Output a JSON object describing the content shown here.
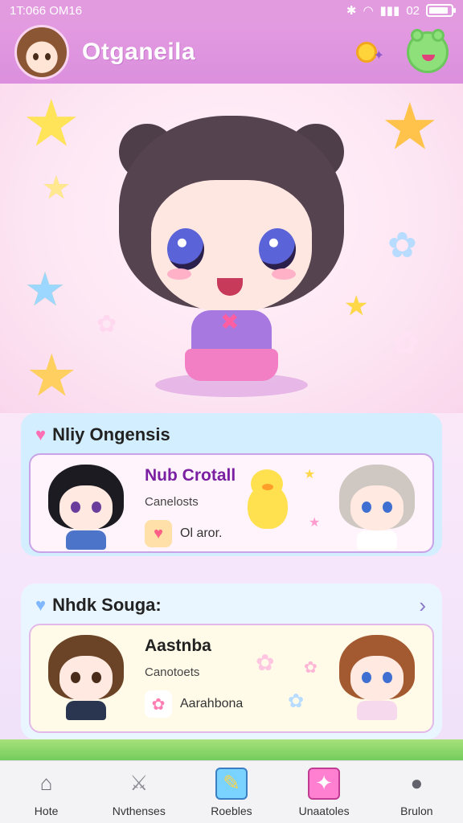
{
  "status_bar": {
    "time": "1T:066 OM16",
    "carrier": "02",
    "battery_level": 0.9
  },
  "header": {
    "title": "Otganeila"
  },
  "section_one": {
    "title": "Nliy Ongensis",
    "card": {
      "name": "Nub Crotall",
      "subtitle": "Canelosts",
      "meta": "Ol aror."
    }
  },
  "section_two": {
    "title": "Nhdk Souga:",
    "card": {
      "name": "Aastnba",
      "subtitle": "Canotoets",
      "meta": "Aarahbona"
    }
  },
  "bottom_nav": {
    "items": [
      {
        "label": "Hote",
        "icon": "home-icon"
      },
      {
        "label": "Nvthenses",
        "icon": "battle-icon"
      },
      {
        "label": "Roebles",
        "icon": "roster-icon"
      },
      {
        "label": "Unaatoles",
        "icon": "gacha-icon"
      },
      {
        "label": "Brulon",
        "icon": "profile-icon"
      }
    ]
  },
  "colors": {
    "header": "#e39be0",
    "accent_purple": "#7b1fa2",
    "card_blue": "#d3efff"
  }
}
